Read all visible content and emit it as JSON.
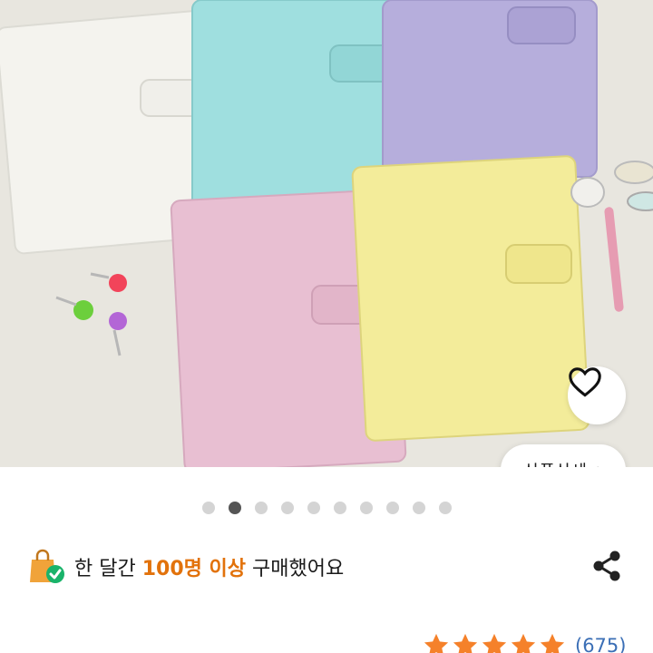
{
  "photo": {
    "description_alt": ""
  },
  "wishlist": {
    "icon": "heart-outline-icon"
  },
  "detail_button": {
    "label": "상품상세",
    "chevron": "›"
  },
  "pager": {
    "count": 10,
    "active_index": 1
  },
  "purchase_info": {
    "prefix": "한 달간",
    "highlight": "100명 이상",
    "suffix": "구매했어요",
    "highlight_color": "#e2720b",
    "icon": "shopping-bag-check-icon"
  },
  "share": {
    "icon": "share-icon"
  },
  "rating": {
    "stars": 5,
    "count_text": "(675)",
    "star_color": "#f5812a"
  }
}
